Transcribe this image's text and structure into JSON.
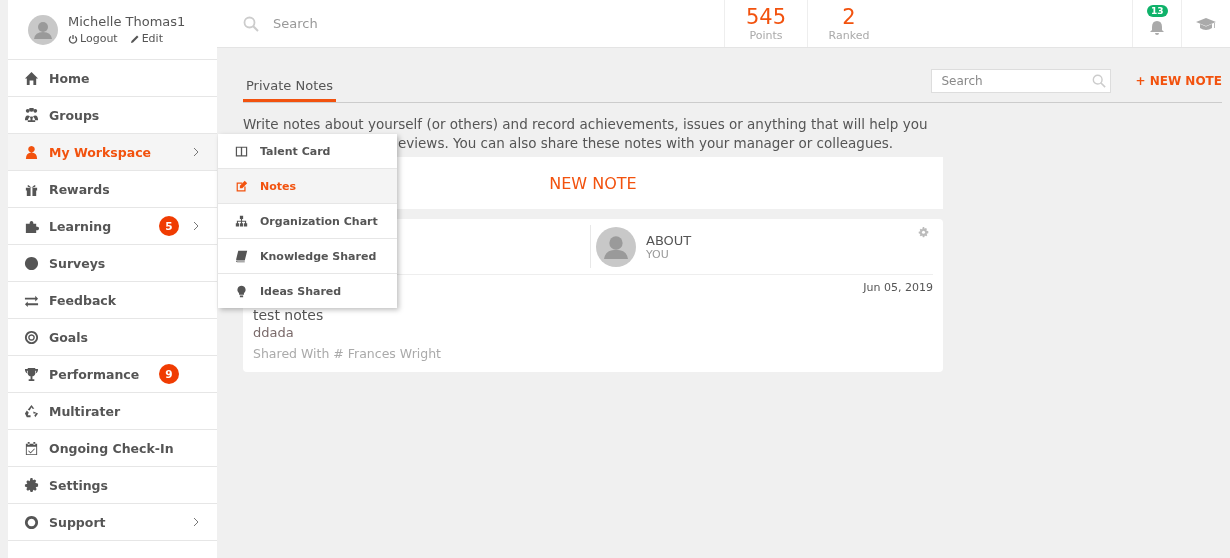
{
  "user": {
    "name": "Michelle Thomas1",
    "logout": "Logout",
    "edit": "Edit"
  },
  "search": {
    "placeholder": "Search"
  },
  "stats": [
    {
      "value": "545",
      "label": "Points"
    },
    {
      "value": "2",
      "label": "Ranked"
    }
  ],
  "notifications": {
    "count": "13"
  },
  "sidebar": {
    "items": [
      {
        "label": "Home",
        "selected": false,
        "expandable": false
      },
      {
        "label": "Groups",
        "selected": false,
        "expandable": false
      },
      {
        "label": "My Workspace",
        "selected": true,
        "expandable": true
      },
      {
        "label": "Rewards",
        "selected": false,
        "expandable": false
      },
      {
        "label": "Learning",
        "selected": false,
        "badge": "5",
        "expandable": true
      },
      {
        "label": "Surveys",
        "selected": false,
        "expandable": false
      },
      {
        "label": "Feedback",
        "selected": false,
        "expandable": false
      },
      {
        "label": "Goals",
        "selected": false,
        "expandable": false
      },
      {
        "label": "Performance",
        "selected": false,
        "badge": "9",
        "expandable": false
      },
      {
        "label": "Multirater",
        "selected": false,
        "expandable": false
      },
      {
        "label": "Ongoing Check-In",
        "selected": false,
        "expandable": false
      },
      {
        "label": "Settings",
        "selected": false,
        "expandable": false
      },
      {
        "label": "Support",
        "selected": false,
        "expandable": true
      }
    ]
  },
  "submenu": {
    "items": [
      {
        "label": "Talent Card",
        "selected": false
      },
      {
        "label": "Notes",
        "selected": true
      },
      {
        "label": "Organization Chart",
        "selected": false
      },
      {
        "label": "Knowledge Shared",
        "selected": false
      },
      {
        "label": "Ideas Shared",
        "selected": false
      }
    ]
  },
  "tabs": [
    {
      "label": "Private Notes",
      "selected": true
    }
  ],
  "notes_search": {
    "placeholder": "Search"
  },
  "new_note_link": "+ NEW NOTE",
  "description": {
    "line_1": "Write notes about yourself (or others) and record achievements, issues or anything that will help you",
    "line_2": "eviews. You can also share these notes with your manager or colleagues."
  },
  "new_note_button": "NEW NOTE",
  "note": {
    "about_label": "ABOUT",
    "about_value": "YOU",
    "date": "Jun 05, 2019",
    "title": "test notes",
    "body": "ddada",
    "shared_with": "Shared With # Frances Wright"
  }
}
